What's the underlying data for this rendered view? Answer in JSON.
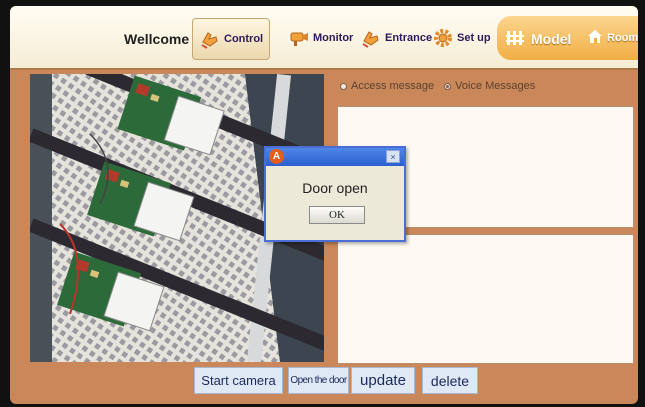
{
  "header": {
    "welcome": "Wellcome",
    "nav": [
      {
        "label": "Control",
        "icon": "hand-pointer-icon"
      },
      {
        "label": "Monitor",
        "icon": "camera-icon"
      },
      {
        "label": "Entrance",
        "icon": "hand-pointer-icon"
      },
      {
        "label": "Set up",
        "icon": "gear-icon"
      }
    ],
    "model_label": "Model",
    "room_label": "Room"
  },
  "messages": {
    "options": [
      "Access message",
      "Voice Messages"
    ],
    "selected": "Voice Messages"
  },
  "dialog": {
    "icon_letter": "A",
    "close_glyph": "×",
    "message": "Door open",
    "ok_label": "OK"
  },
  "actions": {
    "start_camera": "Start camera",
    "open_door": "Open the door",
    "update": "update",
    "delete": "delete"
  },
  "colors": {
    "panel_background": "#c9875a",
    "model_tab": "#f0ae45",
    "dialog_titlebar": "#2a5fcf"
  }
}
